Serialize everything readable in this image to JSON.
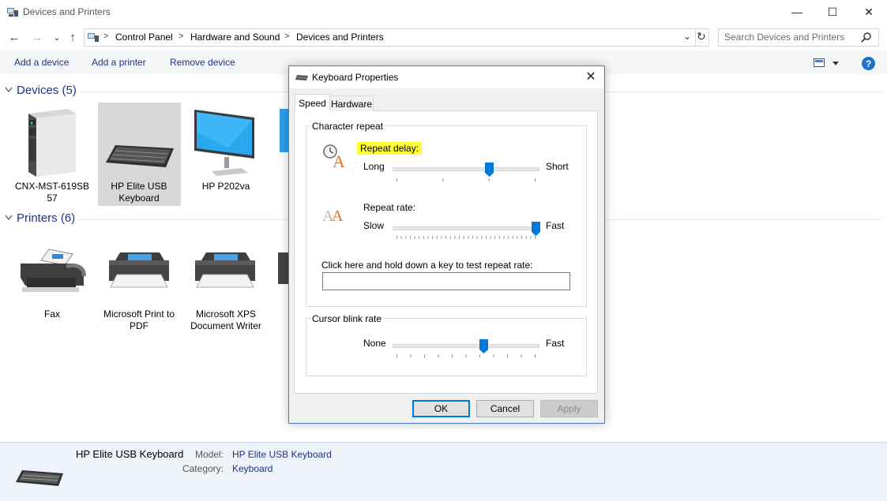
{
  "window": {
    "title": "Devices and Printers",
    "minimize_glyph": "—",
    "maximize_glyph": "☐",
    "close_glyph": "✕"
  },
  "nav": {
    "back_glyph": "←",
    "forward_glyph": "→",
    "recent_glyph": "⌄",
    "up_glyph": "↑",
    "breadcrumbs": [
      "Control Panel",
      "Hardware and Sound",
      "Devices and Printers"
    ],
    "separator": ">",
    "dropdown_glyph": "⌄",
    "refresh_glyph": "↻",
    "search_placeholder": "Search Devices and Printers"
  },
  "commands": [
    "Add a device",
    "Add a printer",
    "Remove device"
  ],
  "help_glyph": "?",
  "devices_group": {
    "header": "Devices (5)",
    "items": [
      {
        "label": "CNX-MST-619SB 57",
        "icon": "computer-tower-icon"
      },
      {
        "label": "HP Elite USB Keyboard",
        "icon": "keyboard-icon",
        "selected": true
      },
      {
        "label": "HP P202va",
        "icon": "monitor-icon"
      }
    ]
  },
  "printers_group": {
    "header": "Printers (6)",
    "items": [
      {
        "label": "Fax",
        "icon": "fax-icon"
      },
      {
        "label": "Microsoft Print to PDF",
        "icon": "printer-icon"
      },
      {
        "label": "Microsoft XPS Document Writer",
        "icon": "printer-icon"
      }
    ]
  },
  "details": {
    "name": "HP Elite USB Keyboard",
    "model_label": "Model:",
    "model_value": "HP Elite USB Keyboard",
    "category_label": "Category:",
    "category_value": "Keyboard"
  },
  "dialog": {
    "title": "Keyboard Properties",
    "close_glyph": "✕",
    "tabs": [
      "Speed",
      "Hardware"
    ],
    "active_tab": "Speed",
    "character_repeat": {
      "title": "Character repeat",
      "repeat_delay": {
        "label": "Repeat delay:",
        "min_label": "Long",
        "max_label": "Short",
        "value": 0.67,
        "ticks": 4
      },
      "repeat_rate": {
        "label": "Repeat rate:",
        "min_label": "Slow",
        "max_label": "Fast",
        "value": 1.0,
        "ticks": 32
      },
      "test_label": "Click here and hold down a key to test repeat rate:",
      "test_value": ""
    },
    "cursor_blink": {
      "title": "Cursor blink rate",
      "min_label": "None",
      "max_label": "Fast",
      "value": 0.63,
      "ticks": 11
    },
    "buttons": {
      "ok": "OK",
      "cancel": "Cancel",
      "apply": "Apply"
    }
  },
  "colors": {
    "accent": "#0078d7",
    "link": "#1e3287",
    "highlight": "#ffff33",
    "selection": "#d8d8d8"
  }
}
